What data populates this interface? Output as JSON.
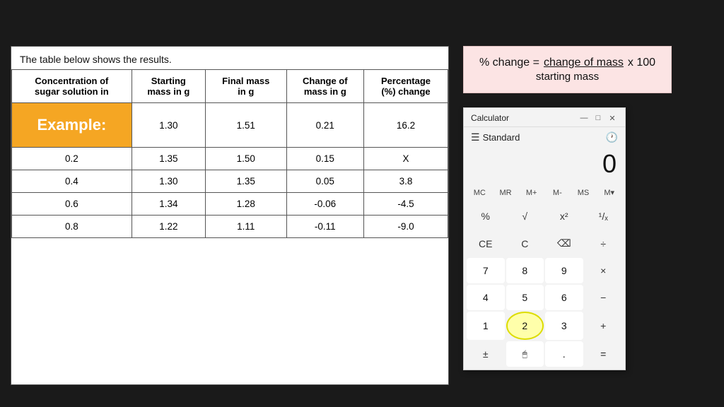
{
  "description": "The table below shows the results.",
  "table": {
    "headers": [
      "Concentration of\nsugar solution in",
      "Starting\nmass in g",
      "Final mass\nin g",
      "Change of\nmass in g",
      "Percentage\n(%) change"
    ],
    "rows": [
      {
        "concentration": "example",
        "starting_mass": "1.30",
        "final_mass": "1.51",
        "change_of_mass": "0.21",
        "percentage_change": "16.2"
      },
      {
        "concentration": "0.2",
        "starting_mass": "1.35",
        "final_mass": "1.50",
        "change_of_mass": "0.15",
        "percentage_change": "X"
      },
      {
        "concentration": "0.4",
        "starting_mass": "1.30",
        "final_mass": "1.35",
        "change_of_mass": "0.05",
        "percentage_change": "3.8"
      },
      {
        "concentration": "0.6",
        "starting_mass": "1.34",
        "final_mass": "1.28",
        "change_of_mass": "-0.06",
        "percentage_change": "-4.5"
      },
      {
        "concentration": "0.8",
        "starting_mass": "1.22",
        "final_mass": "1.11",
        "change_of_mass": "-0.11",
        "percentage_change": "-9.0"
      }
    ]
  },
  "formula": {
    "prefix": "% change =",
    "numerator": "change of mass",
    "multiply": "x 100",
    "denominator": "starting mass"
  },
  "calculator": {
    "title": "Calculator",
    "mode": "Standard",
    "display": "0",
    "memory_buttons": [
      "MC",
      "MR",
      "M+",
      "M-",
      "MS",
      "M▾"
    ],
    "buttons": [
      [
        "%",
        "√",
        "x²",
        "¹/ₓ"
      ],
      [
        "CE",
        "C",
        "⌫",
        "÷"
      ],
      [
        "7",
        "8",
        "9",
        "×"
      ],
      [
        "4",
        "5",
        "6",
        "−"
      ],
      [
        "1",
        "2",
        "3",
        "+"
      ],
      [
        "±",
        "0",
        ".",
        "="
      ]
    ]
  }
}
